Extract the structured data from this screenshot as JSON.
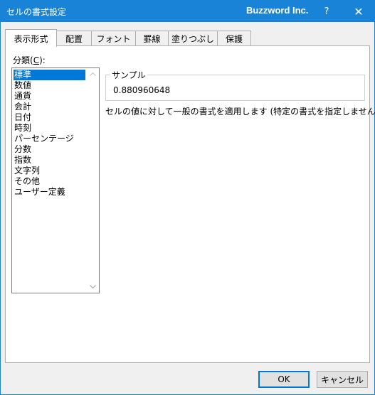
{
  "window": {
    "title": "セルの書式設定",
    "brand": "Buzzword Inc.",
    "help_label": "?",
    "close_label": "✕"
  },
  "tabs": [
    {
      "label": "表示形式",
      "active": true
    },
    {
      "label": "配置"
    },
    {
      "label": "フォント"
    },
    {
      "label": "罫線"
    },
    {
      "label": "塗りつぶし"
    },
    {
      "label": "保護"
    }
  ],
  "category": {
    "label_prefix": "分類(",
    "label_accel": "C",
    "label_suffix": "):",
    "items": [
      "標準",
      "数値",
      "通貨",
      "会計",
      "日付",
      "時刻",
      "パーセンテージ",
      "分数",
      "指数",
      "文字列",
      "その他",
      "ユーザー定義"
    ],
    "selected": "標準"
  },
  "sample": {
    "legend": "サンプル",
    "value": "0.880960648"
  },
  "description": "セルの値に対して一般の書式を適用します (特定の書式を指定しません)。",
  "buttons": {
    "ok": "OK",
    "cancel": "キャンセル"
  },
  "colors": {
    "titlebar": "#1883d7",
    "selection": "#0078d7"
  },
  "icons": {
    "help": "question-mark-icon",
    "close": "close-icon",
    "scroll_up": "chevron-up-icon",
    "scroll_down": "chevron-down-icon"
  }
}
